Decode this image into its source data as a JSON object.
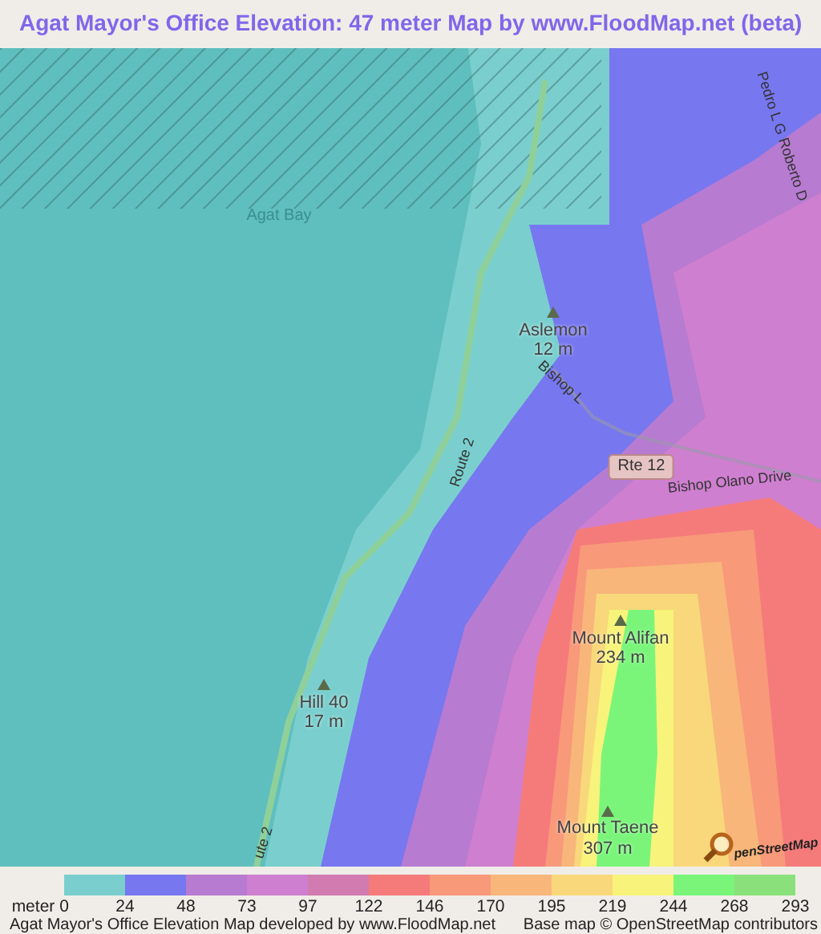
{
  "title": "Agat Mayor's Office Elevation: 47 meter Map by www.FloodMap.net (beta)",
  "map": {
    "labels": [
      {
        "text": "Agat Bay",
        "kind": "water"
      },
      {
        "text": "Pedro L G Roberto D",
        "kind": "road"
      },
      {
        "text": "Aslemon",
        "kind": "place"
      },
      {
        "text": "12 m",
        "kind": "place"
      },
      {
        "text": "Bishop L",
        "kind": "road"
      },
      {
        "text": "Route 2",
        "kind": "road"
      },
      {
        "text": "Rte 12",
        "kind": "shield"
      },
      {
        "text": "Bishop Olano Drive",
        "kind": "road"
      },
      {
        "text": "Mount Alifan",
        "kind": "place"
      },
      {
        "text": "234 m",
        "kind": "place"
      },
      {
        "text": "Hill 40",
        "kind": "place"
      },
      {
        "text": "17 m",
        "kind": "place"
      },
      {
        "text": "Mount Taene",
        "kind": "place"
      },
      {
        "text": "307 m",
        "kind": "place"
      },
      {
        "text": "ute 2",
        "kind": "road"
      },
      {
        "text": "penStreetMap",
        "kind": "logo"
      }
    ]
  },
  "legend": {
    "unit": "meter",
    "swatches": [
      {
        "color": "#7acfce"
      },
      {
        "color": "#7777f0"
      },
      {
        "color": "#b77bd1"
      },
      {
        "color": "#cf7fcf"
      },
      {
        "color": "#d17bb1"
      },
      {
        "color": "#f57b7b"
      },
      {
        "color": "#f8997a"
      },
      {
        "color": "#f8b67a"
      },
      {
        "color": "#f8d87a"
      },
      {
        "color": "#f8f37a"
      },
      {
        "color": "#7af57a"
      },
      {
        "color": "#8ae07a"
      }
    ],
    "ticks": [
      "0",
      "24",
      "48",
      "73",
      "97",
      "122",
      "146",
      "170",
      "195",
      "219",
      "244",
      "268",
      "293"
    ]
  },
  "footer": {
    "left": "Agat Mayor's Office Elevation Map developed by www.FloodMap.net",
    "right": "Base map © OpenStreetMap contributors"
  }
}
